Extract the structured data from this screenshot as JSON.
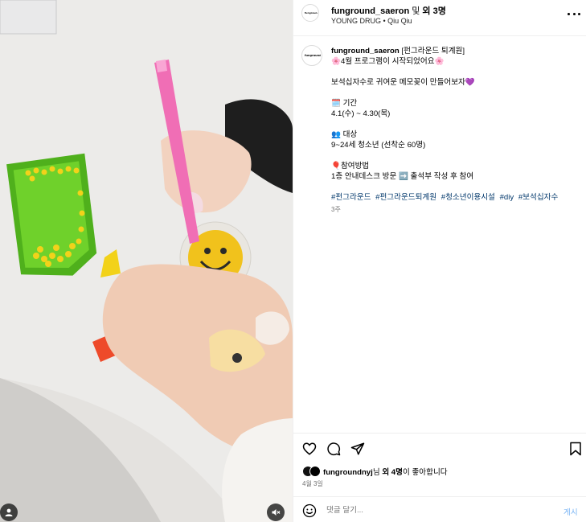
{
  "header": {
    "username": "funground_saeron",
    "and_label": "및",
    "others": "외 3명",
    "subtitle": "YOUNG DRUG • Qiu Qiu",
    "avatar_text": "funground"
  },
  "caption": {
    "username": "funground_saeron",
    "title": "[펀그라운드 퇴계원]",
    "line1": "🌸4월 프로그램이 시작되었어요🌸",
    "line2": "보석십자수로 귀여운 메모꽂이 만들어보자💜",
    "period_label": "🗓️ 기간",
    "period_value": "4.1(수) ~ 4.30(목)",
    "target_label": "👥 대상",
    "target_value": "9~24세 청소년 (선착순 60명)",
    "method_label": "🎈참여방법",
    "method_value": "1층 안내데스크 방문 ➡️ 출석부 작성 후 참여",
    "hashtags": [
      "#펀그라운드",
      "#펀그라운드퇴계원",
      "#청소년이용시설",
      "#diy",
      "#보석십자수"
    ],
    "time": "3주"
  },
  "actions": {
    "icons": [
      "heart-icon",
      "comment-icon",
      "share-icon",
      "bookmark-icon"
    ]
  },
  "likes": {
    "user": "fungroundnyj",
    "suffix": "님",
    "others": "외 4명",
    "tail": "이 좋아합니다"
  },
  "date": "4월 3일",
  "comment": {
    "placeholder": "댓글 달기...",
    "post_label": "게시"
  },
  "colors": {
    "hashtag": "#00376b",
    "post_button": "#7ab5f5",
    "muted": "#737373",
    "border": "#efefef"
  }
}
